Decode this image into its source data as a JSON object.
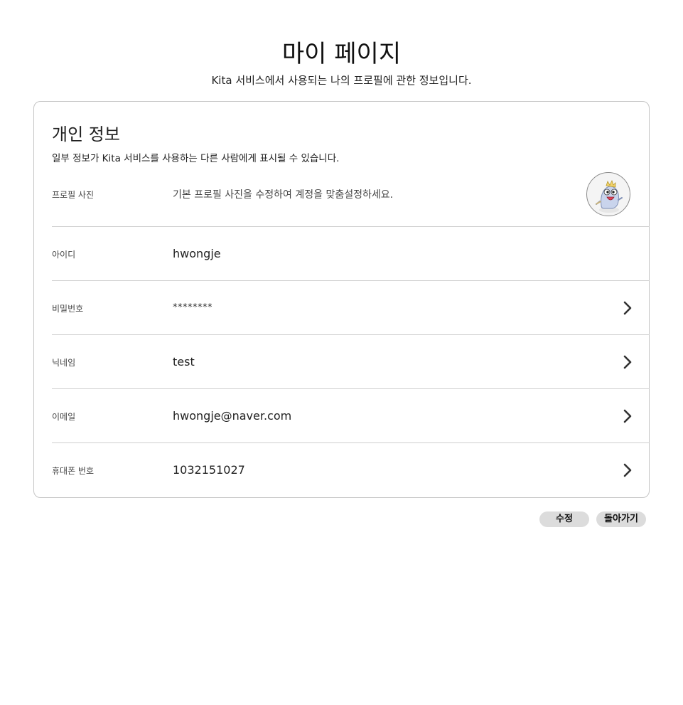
{
  "header": {
    "title": "마이 페이지",
    "subtitle": "Kita 서비스에서 사용되는 나의 프로필에 관한 정보입니다."
  },
  "card": {
    "title": "개인 정보",
    "description": "일부 정보가 Kita 서비스를 사용하는 다른 사람에게 표시될 수 있습니다.",
    "rows": [
      {
        "label": "프로필 사진",
        "value": "기본 프로필 사진을 수정하여 계정을 맞춤설정하세요.",
        "icon": "avatar-dinosaur"
      },
      {
        "label": "아이디",
        "value": "hwongje"
      },
      {
        "label": "비밀번호",
        "value": "********",
        "icon": "chevron-right-icon"
      },
      {
        "label": "닉네임",
        "value": "test",
        "icon": "chevron-right-icon"
      },
      {
        "label": "이메일",
        "value": "hwongje@naver.com",
        "icon": "chevron-right-icon"
      },
      {
        "label": "휴대폰 번호",
        "value": "1032151027",
        "icon": "chevron-right-icon"
      }
    ]
  },
  "actions": {
    "edit_label": "수정",
    "back_label": "돌아가기"
  },
  "colors": {
    "button_bg": "#dcdcdc",
    "border": "#c4c4c4",
    "divider": "#cfcfcf"
  }
}
